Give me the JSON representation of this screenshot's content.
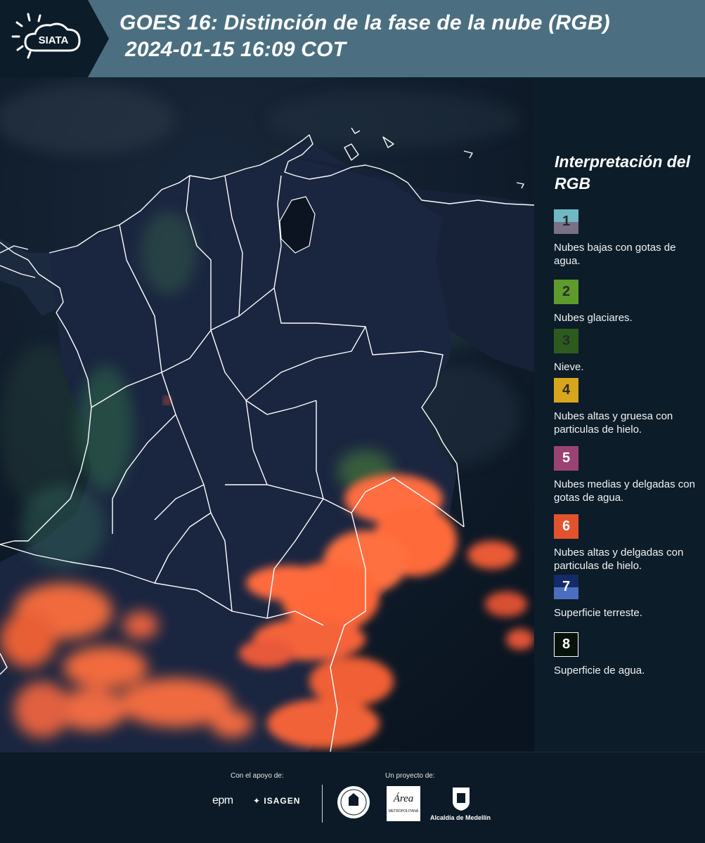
{
  "header": {
    "logo_text": "SIATA",
    "title_line1": "GOES 16: Distinción de la fase de la nube (RGB)",
    "title_line2": "2024-01-15 16:09 COT"
  },
  "legend": {
    "title": "Interpretación del RGB",
    "items": [
      {
        "number": "1",
        "label": "Nubes bajas con gotas de agua.",
        "color_top": "#6fb8c4",
        "color_bottom": "#7a7088"
      },
      {
        "number": "2",
        "label": "Nubes glaciares.",
        "color": "#5e9b2c"
      },
      {
        "number": "3",
        "label": "Nieve.",
        "color": "#2d5b1e"
      },
      {
        "number": "4",
        "label": "Nubes altas y gruesa con particulas de hielo.",
        "color": "#d8a61e"
      },
      {
        "number": "5",
        "label": "Nubes medias y delgadas con gotas de agua.",
        "color": "#9a4372"
      },
      {
        "number": "6",
        "label": "Nubes altas y delgadas con particulas de hielo.",
        "color": "#e2532d"
      },
      {
        "number": "7",
        "label": "Superficie terreste.",
        "color_top": "#132b66",
        "color_bottom": "#4a6fbe"
      },
      {
        "number": "8",
        "label": "Superficie de agua.",
        "color": "#07120b"
      }
    ]
  },
  "footer": {
    "support_label": "Con el apoyo de:",
    "project_label": "Un proyecto de:",
    "epm_logo": "epm",
    "isagen_logo": "ISAGEN",
    "metropolitana_logo": "Área",
    "metropolitana_sub": "METROPOLITANA",
    "medellin_logo": "Alcaldía de Medellín"
  },
  "colors": {
    "header_bg": "#4b6f80",
    "logo_bg": "#0c1c29",
    "legend_bg": "#0c1c29",
    "cloud_orange": "#ff6a3a",
    "land_blue": "#1d2a4a",
    "ocean": "#0c1622"
  }
}
